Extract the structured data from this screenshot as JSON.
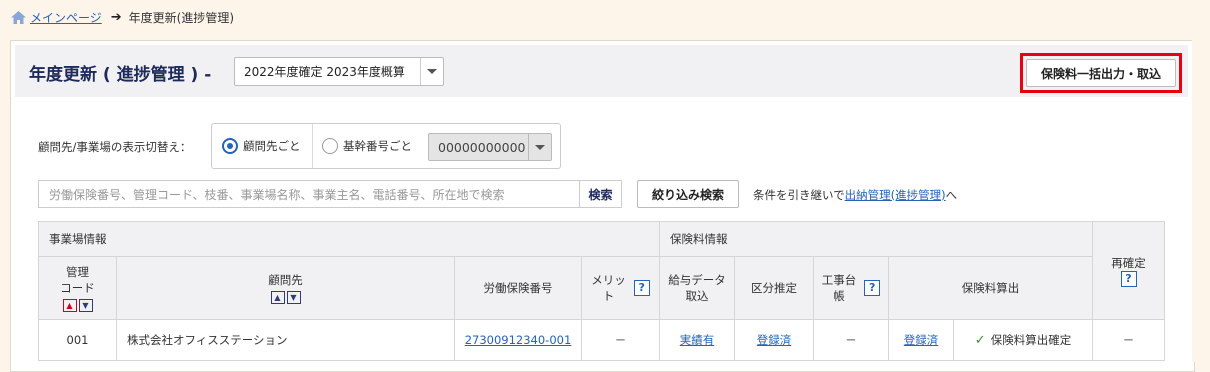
{
  "breadcrumb": {
    "home_link": "メインページ",
    "current": "年度更新(進捗管理)"
  },
  "header": {
    "title": "年度更新 ( 進捗管理 ) -",
    "year_select": "2022年度確定 2023年度概算",
    "bulk_button": "保険料一括出力・取込"
  },
  "switch": {
    "label": "顧問先/事業場の表示切替え：",
    "option_client": "顧問先ごと",
    "option_base": "基幹番号ごと",
    "code_select": "00000000000"
  },
  "search": {
    "placeholder": "労働保険番号、管理コード、枝番、事業場名称、事業主名、電話番号、所在地で検索",
    "button": "検索",
    "filter_button": "絞り込み検索",
    "cond_prefix": "条件を引き継いで",
    "cond_link": "出納管理(進捗管理)",
    "cond_suffix": "へ"
  },
  "table": {
    "group_office": "事業場情報",
    "group_premium": "保険料情報",
    "col_code_1": "管理",
    "col_code_2": "コード",
    "col_client": "顧問先",
    "col_labor_no": "労働保険番号",
    "col_merit_1": "メリッ",
    "col_merit_2": "ト",
    "col_salary_1": "給与データ",
    "col_salary_2": "取込",
    "col_class": "区分推定",
    "col_ledger_1": "工事台",
    "col_ledger_2": "帳",
    "col_calc": "保険料算出",
    "col_reconfirm": "再確定",
    "help_mark": "?",
    "rows": [
      {
        "code": "001",
        "client": "株式会社オフィスステーション",
        "labor_no": "27300912340-001",
        "merit": "－",
        "salary": "実績有",
        "class": "登録済",
        "ledger": "－",
        "calc_link": "登録済",
        "calc_status": "保険料算出確定",
        "reconfirm": "－"
      }
    ]
  },
  "colors": {
    "accent_blue": "#2563b5",
    "title_navy": "#1d2a5a",
    "highlight_red": "#e60012"
  }
}
